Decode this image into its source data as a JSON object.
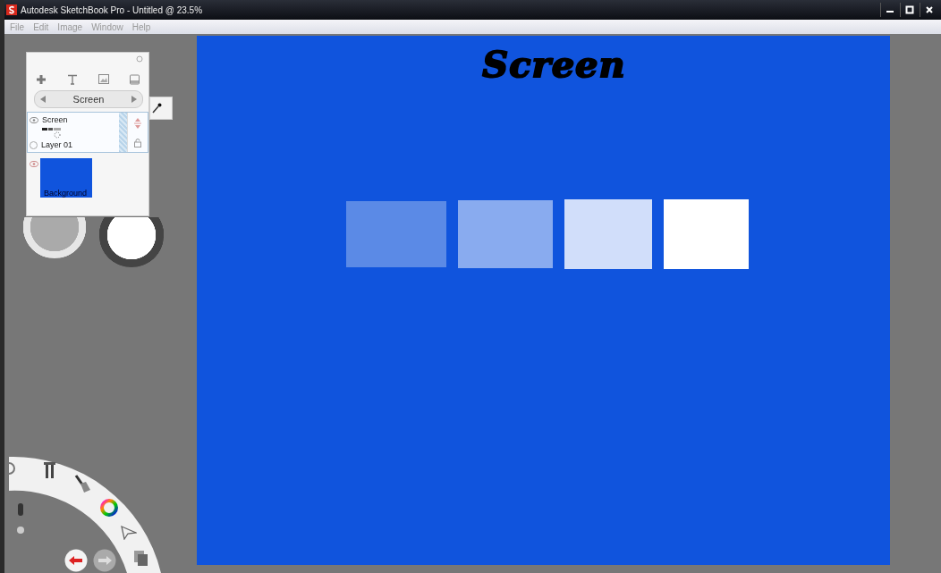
{
  "window": {
    "title": "Autodesk SketchBook Pro - Untitled @ 23.5%"
  },
  "menu": [
    "File",
    "Edit",
    "Image",
    "Window",
    "Help"
  ],
  "layer_panel": {
    "current_layer": "Screen",
    "layers": [
      {
        "name": "Screen",
        "sublabel": "Layer 01",
        "kind": "text",
        "selected": true
      },
      {
        "name": "Background",
        "kind": "fill",
        "selected": false
      }
    ]
  },
  "canvas": {
    "heading": "Screen",
    "swatches": [
      {
        "color": "#5b8ae6"
      },
      {
        "color": "#89abef"
      },
      {
        "color": "#d1defa"
      },
      {
        "color": "#ffffff"
      }
    ]
  }
}
